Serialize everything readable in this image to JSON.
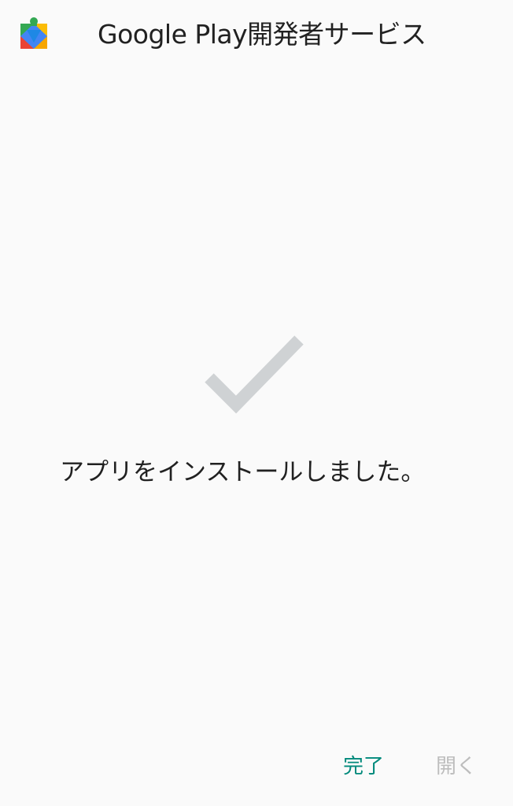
{
  "header": {
    "app_title": "Google Play開発者サービス",
    "icon": "google-play-services-puzzle-icon"
  },
  "main": {
    "status_icon": "checkmark-icon",
    "status_message": "アプリをインストールしました。"
  },
  "actions": {
    "done_label": "完了",
    "open_label": "開く"
  },
  "colors": {
    "accent": "#00897b",
    "disabled": "#bdbdbd",
    "check": "#cfd2d4",
    "background": "#fafafa"
  }
}
